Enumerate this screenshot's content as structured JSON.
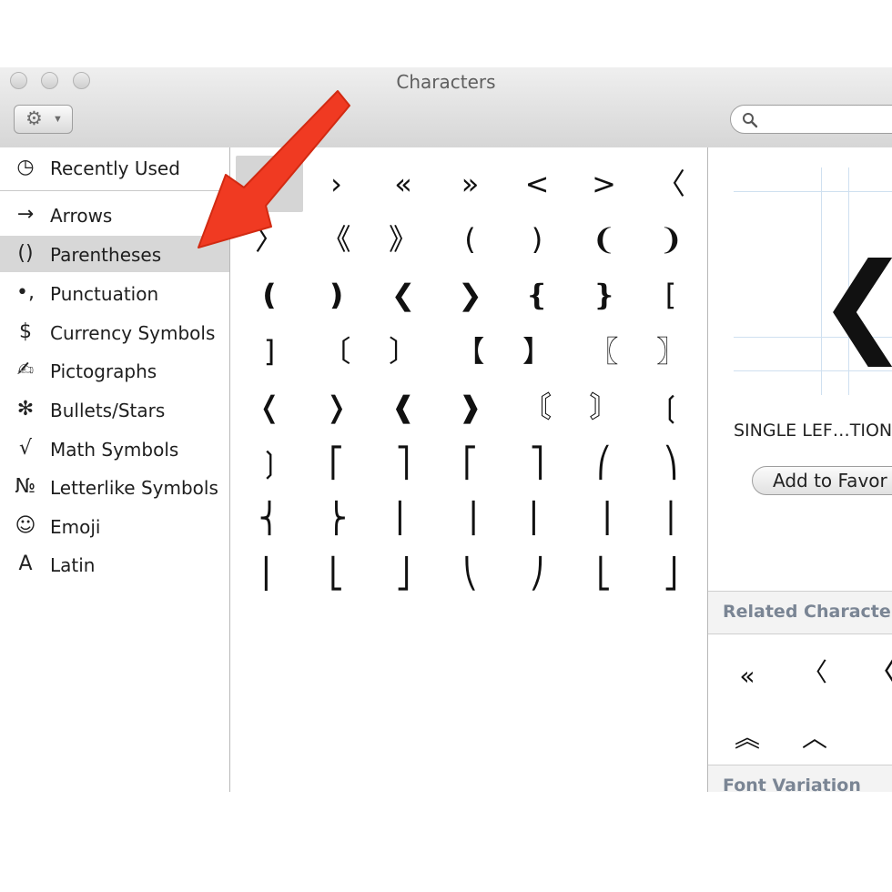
{
  "window": {
    "title": "Characters"
  },
  "toolbar": {
    "gear_icon": "gear-icon",
    "search_placeholder": ""
  },
  "sidebar": {
    "items": [
      {
        "icon": "◷",
        "label": "Recently Used"
      },
      {
        "icon": "→",
        "label": "Arrows"
      },
      {
        "icon": "()",
        "label": "Parentheses",
        "selected": true
      },
      {
        "icon": "•,",
        "label": "Punctuation"
      },
      {
        "icon": "$",
        "label": "Currency Symbols"
      },
      {
        "icon": "✍",
        "label": "Pictographs"
      },
      {
        "icon": "✻",
        "label": "Bullets/Stars"
      },
      {
        "icon": "√",
        "label": "Math Symbols"
      },
      {
        "icon": "№",
        "label": "Letterlike Symbols"
      },
      {
        "icon": "☺",
        "label": "Emoji"
      },
      {
        "icon": "A",
        "label": "Latin"
      }
    ]
  },
  "grid": {
    "characters": [
      "‹",
      "›",
      "«",
      "»",
      "<",
      ">",
      "〈",
      "〉",
      "《",
      "》",
      "(",
      ")",
      "❨",
      "❩",
      "❪",
      "❫",
      "❮",
      "❯",
      "❴",
      "❵",
      "[",
      "]",
      "〔",
      "〕",
      "【",
      "】",
      "〖",
      "〗",
      "❬",
      "❭",
      "❰",
      "❱",
      "〘",
      "〙",
      "❲",
      "❳",
      "⎡",
      "⎤",
      "⎡",
      "⎤",
      "⎛",
      "⎞",
      "⎨",
      "⎬",
      "⎜",
      "⎟",
      "⎢",
      "⎥",
      "⎪",
      "⎜",
      "⎣",
      "⎦",
      "⎝",
      "⎠",
      "⎣",
      "⎦"
    ],
    "selected_index": 0
  },
  "info": {
    "preview_glyph": "❮",
    "char_name": "SINGLE LEF…TION",
    "add_favorites_label": "Add to Favor",
    "related_title": "Related Characte",
    "related": [
      "«",
      "〈",
      "〈",
      "︽",
      "︿"
    ],
    "font_variation_title": "Font Variation",
    "variations": [
      "‹",
      "‹",
      "‹"
    ]
  }
}
